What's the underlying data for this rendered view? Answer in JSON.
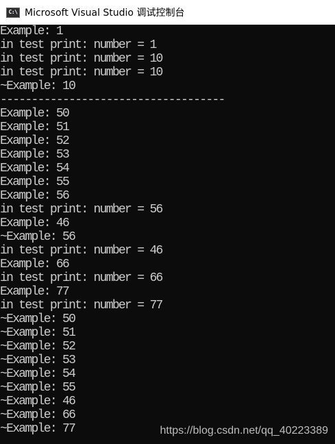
{
  "window": {
    "title": "Microsoft Visual Studio 调试控制台",
    "icon_label": "C:\\",
    "icon": "console-app-icon"
  },
  "console": {
    "lines": [
      "Example: 1",
      "in test print: number = 1",
      "in test print: number = 10",
      "in test print: number = 10",
      "~Example: 10",
      "------------------------------------",
      "Example: 50",
      "Example: 51",
      "Example: 52",
      "Example: 53",
      "Example: 54",
      "Example: 55",
      "Example: 56",
      "in test print: number = 56",
      "Example: 46",
      "~Example: 56",
      "in test print: number = 46",
      "Example: 66",
      "in test print: number = 66",
      "Example: 77",
      "in test print: number = 77",
      "~Example: 50",
      "~Example: 51",
      "~Example: 52",
      "~Example: 53",
      "~Example: 54",
      "~Example: 55",
      "~Example: 46",
      "~Example: 66",
      "~Example: 77"
    ]
  },
  "watermark": "https://blog.csdn.net/qq_40223389",
  "colors": {
    "console_background": "#0c0c0c",
    "console_text": "#cccccc",
    "titlebar_background": "#ffffff"
  }
}
